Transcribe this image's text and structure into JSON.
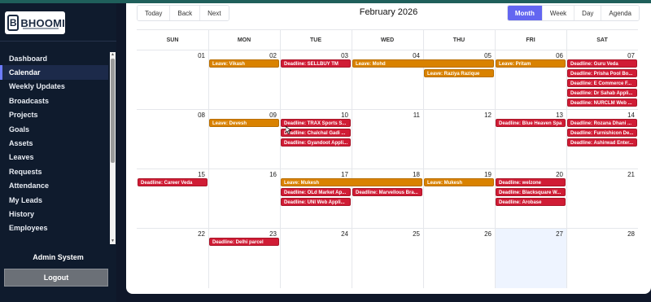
{
  "brand": {
    "logo_text": "BHOOMI",
    "logo_mark": "B"
  },
  "sidebar": {
    "items": [
      {
        "label": "Dashboard"
      },
      {
        "label": "Calendar",
        "active": true
      },
      {
        "label": "Weekly Updates"
      },
      {
        "label": "Broadcasts"
      },
      {
        "label": "Projects"
      },
      {
        "label": "Goals"
      },
      {
        "label": "Assets"
      },
      {
        "label": "Leaves"
      },
      {
        "label": "Requests"
      },
      {
        "label": "Attendance"
      },
      {
        "label": "My Leads"
      },
      {
        "label": "History"
      },
      {
        "label": "Employees"
      }
    ],
    "user": "Admin System",
    "logout_label": "Logout"
  },
  "toolbar": {
    "nav_buttons": [
      "Today",
      "Back",
      "Next"
    ],
    "title": "February 2026",
    "view_buttons": [
      "Month",
      "Week",
      "Day",
      "Agenda"
    ],
    "active_view": "Month"
  },
  "calendar": {
    "weekdays": [
      "SUN",
      "MON",
      "TUE",
      "WED",
      "THU",
      "FRI",
      "SAT"
    ],
    "weeks": [
      [
        "01",
        "02",
        "03",
        "04",
        "05",
        "06",
        "07"
      ],
      [
        "08",
        "09",
        "10",
        "11",
        "12",
        "13",
        "14"
      ],
      [
        "15",
        "16",
        "17",
        "18",
        "19",
        "20",
        "21"
      ],
      [
        "22",
        "23",
        "24",
        "25",
        "26",
        "27",
        "28"
      ]
    ],
    "today": "27",
    "colors": {
      "leave": "#d98200",
      "deadline": "#d01c35",
      "accent": "#6366f1",
      "today_bg": "#eef4ff"
    },
    "events": [
      {
        "week": 0,
        "col": 1,
        "span": 1,
        "slot": 0,
        "type": "leave",
        "label": "Leave: Vikash"
      },
      {
        "week": 0,
        "col": 2,
        "span": 1,
        "slot": 0,
        "type": "deadline",
        "label": "Deadline: SELLBUY TM"
      },
      {
        "week": 0,
        "col": 3,
        "span": 2,
        "slot": 0,
        "type": "leave",
        "label": "Leave: Mohd"
      },
      {
        "week": 0,
        "col": 4,
        "span": 1,
        "slot": 1,
        "type": "leave",
        "label": "Leave: Raziya Razique"
      },
      {
        "week": 0,
        "col": 5,
        "span": 1,
        "slot": 0,
        "type": "leave",
        "label": "Leave: Pritam"
      },
      {
        "week": 0,
        "col": 6,
        "span": 1,
        "slot": 0,
        "type": "deadline",
        "label": "Deadline: Guru Veda"
      },
      {
        "week": 0,
        "col": 6,
        "span": 1,
        "slot": 1,
        "type": "deadline",
        "label": "Deadline: Prisha Pool Bo..."
      },
      {
        "week": 0,
        "col": 6,
        "span": 1,
        "slot": 2,
        "type": "deadline",
        "label": "Deadline: E Commerce F..."
      },
      {
        "week": 0,
        "col": 6,
        "span": 1,
        "slot": 3,
        "type": "deadline",
        "label": "Deadline: Dr Sahab Appli..."
      },
      {
        "week": 0,
        "col": 6,
        "span": 1,
        "slot": 4,
        "type": "deadline",
        "label": "Deadline: NURCLM Web ..."
      },
      {
        "week": 1,
        "col": 1,
        "span": 1,
        "slot": 0,
        "type": "leave",
        "label": "Leave: Devesh"
      },
      {
        "week": 1,
        "col": 2,
        "span": 1,
        "slot": 0,
        "type": "deadline",
        "label": "Deadline: TRAX Sports S..."
      },
      {
        "week": 1,
        "col": 2,
        "span": 1,
        "slot": 1,
        "type": "deadline",
        "label": "Deadline: Chalchal Gadi ..."
      },
      {
        "week": 1,
        "col": 2,
        "span": 1,
        "slot": 2,
        "type": "deadline",
        "label": "Deadline: Gyandoot Appli..."
      },
      {
        "week": 1,
        "col": 5,
        "span": 1,
        "slot": 0,
        "type": "deadline",
        "label": "Deadline: Blue Heaven Spa"
      },
      {
        "week": 1,
        "col": 6,
        "span": 1,
        "slot": 0,
        "type": "deadline",
        "label": "Deadline: Rozana Dhani ..."
      },
      {
        "week": 1,
        "col": 6,
        "span": 1,
        "slot": 1,
        "type": "deadline",
        "label": "Deadline: Furnishicon De..."
      },
      {
        "week": 1,
        "col": 6,
        "span": 1,
        "slot": 2,
        "type": "deadline",
        "label": "Deadline: Ashirwad Enter..."
      },
      {
        "week": 2,
        "col": 0,
        "span": 1,
        "slot": 0,
        "type": "deadline",
        "label": "Deadline: Career Veda"
      },
      {
        "week": 2,
        "col": 2,
        "span": 2,
        "slot": 0,
        "type": "leave",
        "label": "Leave: Mukesh"
      },
      {
        "week": 2,
        "col": 2,
        "span": 1,
        "slot": 1,
        "type": "deadline",
        "label": "Deadline: OLd Market Ap..."
      },
      {
        "week": 2,
        "col": 2,
        "span": 1,
        "slot": 2,
        "type": "deadline",
        "label": "Deadline: UNI Web Appli..."
      },
      {
        "week": 2,
        "col": 3,
        "span": 1,
        "slot": 1,
        "type": "deadline",
        "label": "Deadline: Marvellous Bra..."
      },
      {
        "week": 2,
        "col": 4,
        "span": 1,
        "slot": 0,
        "type": "leave",
        "label": "Leave: Mukesh"
      },
      {
        "week": 2,
        "col": 5,
        "span": 1,
        "slot": 0,
        "type": "deadline",
        "label": "Deadline: welzone"
      },
      {
        "week": 2,
        "col": 5,
        "span": 1,
        "slot": 1,
        "type": "deadline",
        "label": "Deadline: Blacksquare W..."
      },
      {
        "week": 2,
        "col": 5,
        "span": 1,
        "slot": 2,
        "type": "deadline",
        "label": "Deadline: Arobase"
      },
      {
        "week": 3,
        "col": 1,
        "span": 1,
        "slot": 0,
        "type": "deadline",
        "label": "Deadline: Delhi parcel"
      }
    ]
  }
}
